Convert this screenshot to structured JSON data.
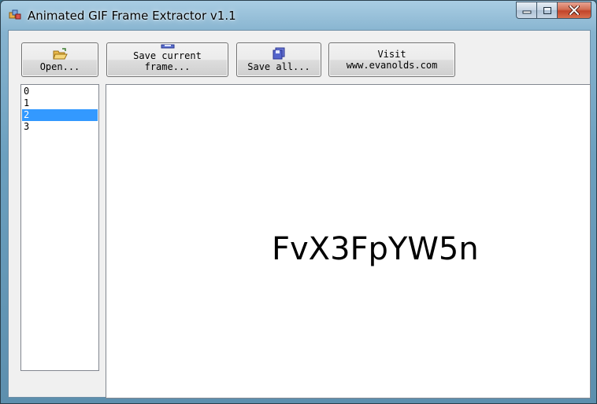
{
  "window": {
    "title": "Animated GIF Frame Extractor v1.1"
  },
  "toolbar": {
    "open_label": "Open...",
    "save_current_line1": "Save current",
    "save_current_line2": "frame...",
    "save_all_label": "Save all...",
    "visit_line1": "Visit",
    "visit_line2": "www.evanolds.com"
  },
  "frames": {
    "items": [
      "0",
      "1",
      "2",
      "3"
    ],
    "selected_index": 2
  },
  "preview": {
    "text": "FvX3FpYW5n"
  },
  "colors": {
    "selection": "#3399ff",
    "close_button": "#c2442a"
  }
}
